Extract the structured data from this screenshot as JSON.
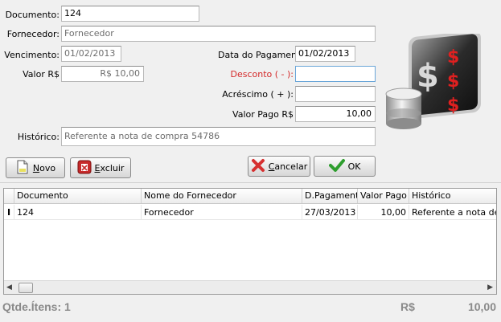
{
  "form": {
    "documento_label": "Documento:",
    "documento_value": "124",
    "fornecedor_label": "Fornecedor:",
    "fornecedor_value": "Fornecedor",
    "vencimento_label": "Vencimento:",
    "vencimento_value": "01/02/2013",
    "data_pagamento_label": "Data do Pagamento",
    "data_pagamento_value": "01/02/2013",
    "valor_label": "Valor R$",
    "valor_value": "R$ 10,00",
    "desconto_label": "Desconto ( - ):",
    "desconto_value": "",
    "acrescimo_label": "Acréscimo ( + ):",
    "acrescimo_value": "",
    "valor_pago_label": "Valor Pago R$",
    "valor_pago_value": "10,00",
    "historico_label": "Histórico:",
    "historico_value": "Referente a nota de compra 54786"
  },
  "buttons": {
    "novo": "Novo",
    "excluir": "Excluir",
    "cancelar": "Cancelar",
    "ok": "OK"
  },
  "grid": {
    "columns": [
      "Documento",
      "Nome do Fornecedor",
      "D.Pagamento",
      "Valor Pago",
      "Histórico"
    ],
    "rows": [
      [
        "124",
        "Fornecedor",
        "27/03/2013",
        "10,00",
        "Referente a nota de co"
      ]
    ]
  },
  "footer": {
    "qtde_label": "Qtde.Ítens:",
    "qtde_value": "1",
    "currency": "R$",
    "total": "10,00"
  },
  "colors": {
    "desconto_label": "#d42a2a",
    "ok_check": "#2e9e2e",
    "cancel_x": "#d63030"
  },
  "icons": {
    "money_logo": "dollar-money-icon",
    "novo": "new-document-icon",
    "excluir": "delete-icon",
    "cancelar": "cancel-x-icon",
    "ok": "check-icon"
  }
}
